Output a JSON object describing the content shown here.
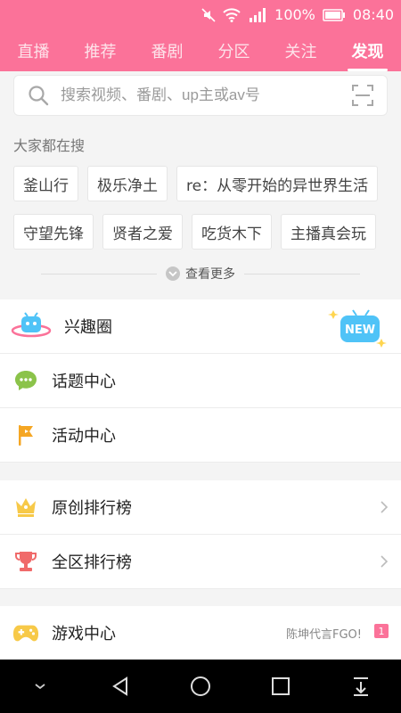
{
  "status": {
    "battery": "100%",
    "time": "08:40"
  },
  "tabs": [
    {
      "label": "直播"
    },
    {
      "label": "推荐"
    },
    {
      "label": "番剧"
    },
    {
      "label": "分区"
    },
    {
      "label": "关注"
    },
    {
      "label": "发现"
    }
  ],
  "search": {
    "placeholder": "搜索视频、番剧、up主或av号"
  },
  "trending": {
    "title": "大家都在搜",
    "row1": [
      "釜山行",
      "极乐净土",
      "re：从零开始的异世界生活"
    ],
    "row2": [
      "守望先锋",
      "贤者之爱",
      "吃货木下",
      "主播真会玩"
    ],
    "more": "查看更多"
  },
  "section1": [
    {
      "label": "兴趣圈",
      "icon": "planet-tv-icon",
      "badge": "NEW"
    },
    {
      "label": "话题中心",
      "icon": "chat-bubble-icon"
    },
    {
      "label": "活动中心",
      "icon": "flag-icon"
    }
  ],
  "section2": [
    {
      "label": "原创排行榜",
      "icon": "crown-icon"
    },
    {
      "label": "全区排行榜",
      "icon": "trophy-icon"
    }
  ],
  "section3": [
    {
      "label": "游戏中心",
      "icon": "gamepad-icon",
      "note": "陈坤代言FGO!",
      "badge": "1"
    }
  ],
  "colors": {
    "accent": "#fb7299"
  }
}
